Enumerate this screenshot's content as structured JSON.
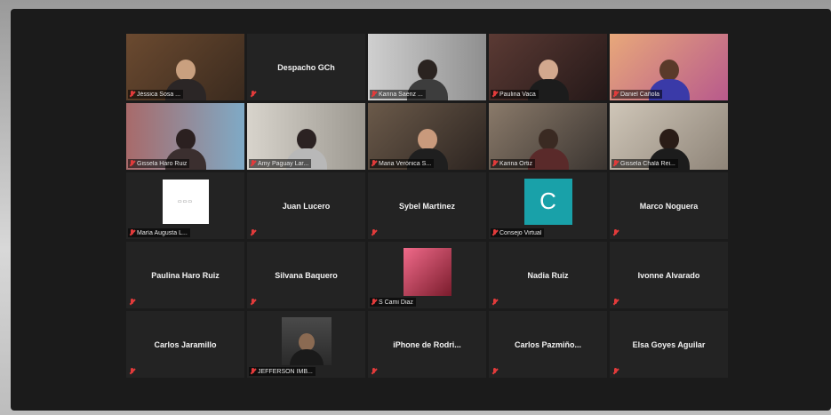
{
  "meeting": {
    "tiles": [
      {
        "name": "Jéssica Sosa ...",
        "kind": "video"
      },
      {
        "name": "Despacho GCh",
        "kind": "text"
      },
      {
        "name": "Karina Saenz ...",
        "kind": "video"
      },
      {
        "name": "Paulina Vaca",
        "kind": "video"
      },
      {
        "name": "Daniel Cañola",
        "kind": "video"
      },
      {
        "name": "Gissela Haro Ruiz",
        "kind": "video"
      },
      {
        "name": "Amy Paguay Lar...",
        "kind": "video"
      },
      {
        "name": "Maria Verónica S...",
        "kind": "video"
      },
      {
        "name": "Karina Ortiz",
        "kind": "video"
      },
      {
        "name": "Gissela Chalá Rei...",
        "kind": "video",
        "active": true
      },
      {
        "name": "María Augusta L...",
        "kind": "logo"
      },
      {
        "name": "Juan Lucero",
        "kind": "text"
      },
      {
        "name": "Sybel Martinez",
        "kind": "text"
      },
      {
        "name": "Consejo Virtual",
        "kind": "avatar",
        "initial": "C"
      },
      {
        "name": "Marco Noguera",
        "kind": "text"
      },
      {
        "name": "Paulina Haro Ruiz",
        "kind": "text"
      },
      {
        "name": "Silvana Baquero",
        "kind": "text"
      },
      {
        "name": "S Cami Diaz",
        "kind": "video"
      },
      {
        "name": "Nadia Ruiz",
        "kind": "text"
      },
      {
        "name": "Ivonne Alvarado",
        "kind": "text"
      },
      {
        "name": "Carlos Jaramillo",
        "kind": "text"
      },
      {
        "name": "JEFFERSON IMB...",
        "kind": "video"
      },
      {
        "name": "iPhone de Rodri...",
        "kind": "text"
      },
      {
        "name": "Carlos Pazmiño...",
        "kind": "text"
      },
      {
        "name": "Elsa Goyes Aguilar",
        "kind": "text"
      }
    ]
  },
  "colors": {
    "active_speaker": "#c7d44b",
    "muted": "#e23b3b",
    "avatar_bg": "#19a1a9"
  }
}
